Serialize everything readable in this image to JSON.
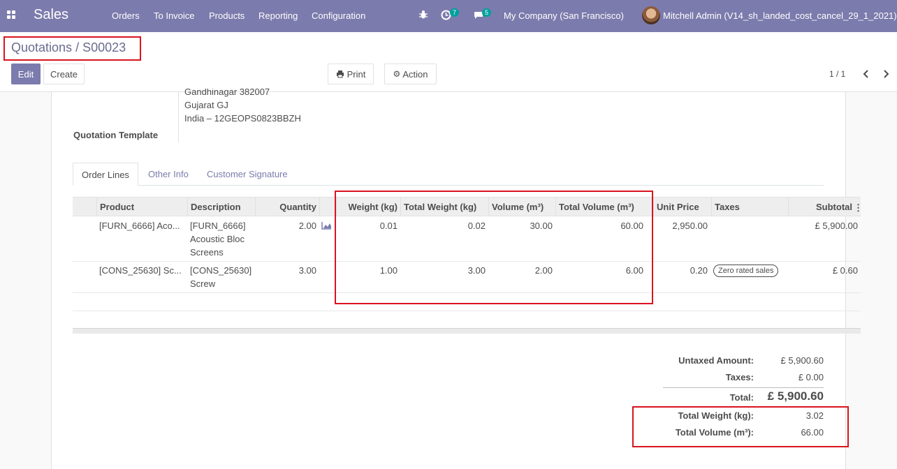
{
  "navbar": {
    "app_name": "Sales",
    "menu": [
      "Orders",
      "To Invoice",
      "Products",
      "Reporting",
      "Configuration"
    ],
    "activity_count": "7",
    "message_count": "5",
    "company": "My Company (San Francisco)",
    "user": "Mitchell Admin (V14_sh_landed_cost_cancel_29_1_2021)"
  },
  "breadcrumb": {
    "parent": "Quotations",
    "separator": "/",
    "current": "S00023"
  },
  "toolbar": {
    "edit": "Edit",
    "create": "Create",
    "print": "Print",
    "action": "Action",
    "pager": "1 / 1"
  },
  "address": {
    "line_partial": "Gandhinagar 382007",
    "line2": "Gujarat GJ",
    "line3": "India – 12GEOPS0823BBZH"
  },
  "field_labels": {
    "quotation_template": "Quotation Template"
  },
  "tabs": [
    "Order Lines",
    "Other Info",
    "Customer Signature"
  ],
  "table": {
    "headers": [
      "Product",
      "Description",
      "Quantity",
      "Weight (kg)",
      "Total Weight (kg)",
      "Volume (m³)",
      "Total Volume (m³)",
      "Unit Price",
      "Taxes",
      "Subtotal"
    ],
    "rows": [
      {
        "product": "[FURN_6666] Aco...",
        "desc1": "[FURN_6666]",
        "desc2": "Acoustic Bloc",
        "desc3": "Screens",
        "qty": "2.00",
        "weight": "0.01",
        "total_weight": "0.02",
        "volume": "30.00",
        "total_volume": "60.00",
        "unit_price": "2,950.00",
        "tax": "",
        "subtotal": "£ 5,900.00"
      },
      {
        "product": "[CONS_25630] Sc...",
        "desc1": "[CONS_25630]",
        "desc2": "Screw",
        "desc3": "",
        "qty": "3.00",
        "weight": "1.00",
        "total_weight": "3.00",
        "volume": "2.00",
        "total_volume": "6.00",
        "unit_price": "0.20",
        "tax": "Zero rated sales",
        "subtotal": "£ 0.60"
      }
    ]
  },
  "totals": {
    "untaxed_label": "Untaxed Amount:",
    "untaxed": "£ 5,900.60",
    "taxes_label": "Taxes:",
    "taxes": "£ 0.00",
    "total_label": "Total:",
    "total": "£ 5,900.60",
    "total_weight_label": "Total Weight (kg):",
    "total_weight": "3.02",
    "total_volume_label": "Total Volume (m³):",
    "total_volume": "66.00"
  },
  "colors": {
    "brand": "#7c7bad",
    "highlight": "#d9131f",
    "badge": "#00a09d"
  }
}
